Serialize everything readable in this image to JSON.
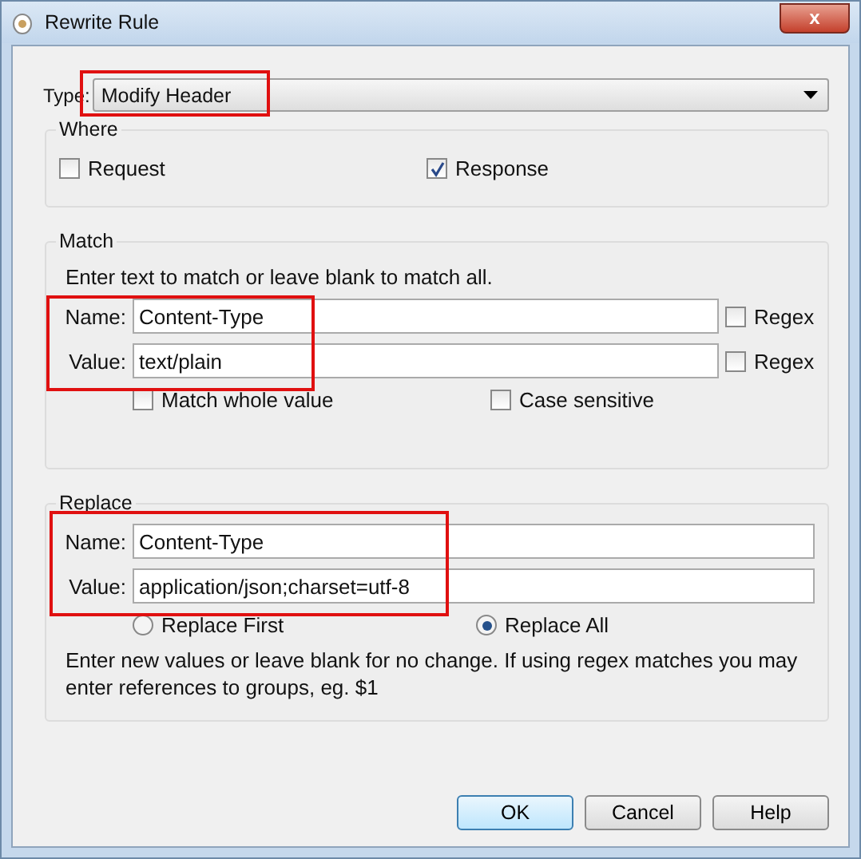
{
  "window": {
    "title": "Rewrite Rule",
    "close": "x"
  },
  "type": {
    "label": "Type:",
    "value": "Modify Header"
  },
  "where": {
    "title": "Where",
    "options": [
      {
        "label": "Request",
        "checked": false
      },
      {
        "label": "Response",
        "checked": true
      }
    ]
  },
  "match": {
    "title": "Match",
    "hint": "Enter text to match or leave blank to match all.",
    "rows": [
      {
        "label": "Name:",
        "value": "Content-Type",
        "regex": {
          "label": "Regex",
          "checked": false
        }
      },
      {
        "label": "Value:",
        "value": "text/plain",
        "regex": {
          "label": "Regex",
          "checked": false
        }
      }
    ],
    "options": [
      {
        "label": "Match whole value",
        "checked": false
      },
      {
        "label": "Case sensitive",
        "checked": false
      }
    ]
  },
  "replace": {
    "title": "Replace",
    "rows": [
      {
        "label": "Name:",
        "value": "Content-Type"
      },
      {
        "label": "Value:",
        "value": "application/json;charset=utf-8"
      }
    ],
    "modes": [
      {
        "label": "Replace First",
        "selected": false
      },
      {
        "label": "Replace All",
        "selected": true
      }
    ],
    "hint": "Enter new values or leave blank for no change. If using regex matches you may enter references to groups, eg. $1"
  },
  "buttons": [
    {
      "label": "OK",
      "default": true
    },
    {
      "label": "Cancel",
      "default": false
    },
    {
      "label": "Help",
      "default": false
    }
  ],
  "annotations": [
    {
      "kind": "rectangle",
      "color": "#e01010"
    },
    {
      "kind": "rectangle",
      "color": "#e01010"
    },
    {
      "kind": "rectangle",
      "color": "#e01010"
    }
  ]
}
